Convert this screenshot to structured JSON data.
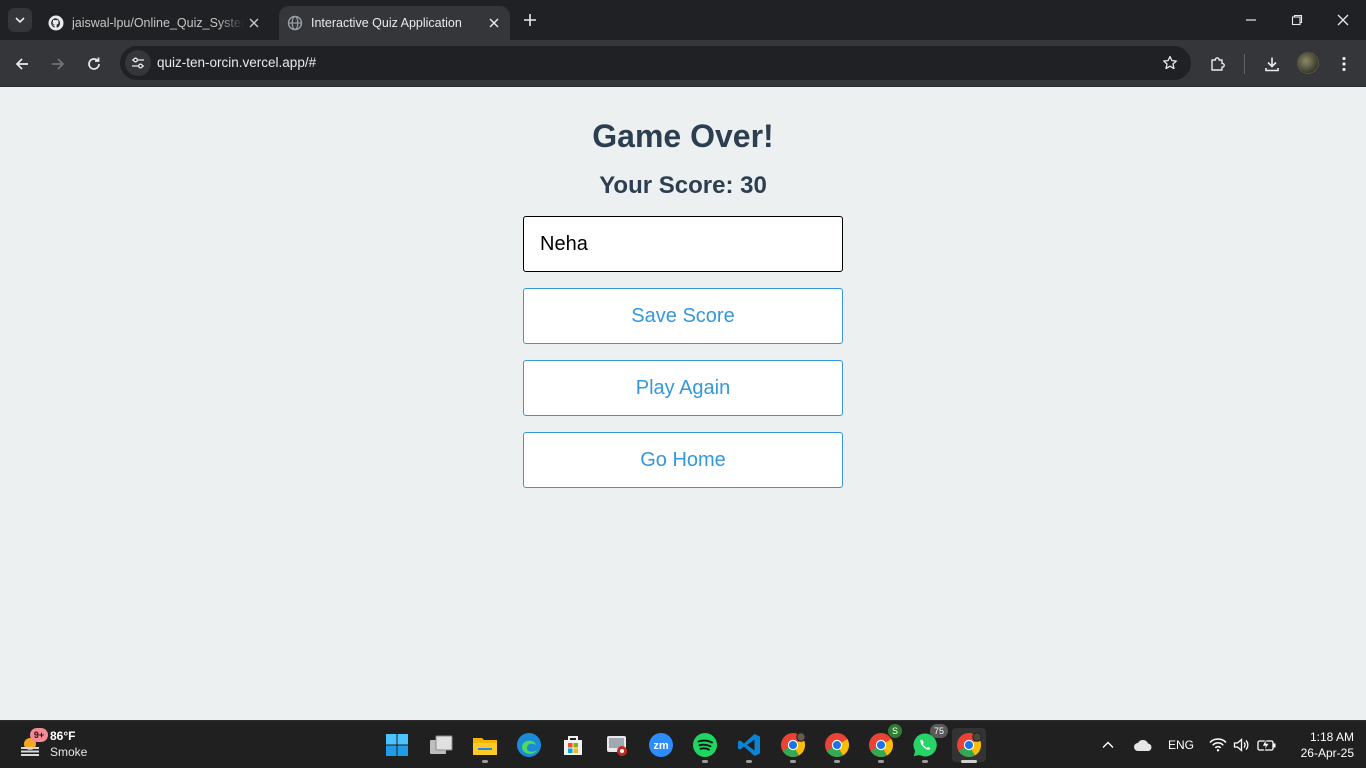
{
  "browser": {
    "tabs": [
      {
        "title": "jaiswal-lpu/Online_Quiz_System",
        "favicon": "github-icon",
        "active": false
      },
      {
        "title": "Interactive Quiz Application",
        "favicon": "globe-icon",
        "active": true
      }
    ],
    "url": "quiz-ten-orcin.vercel.app/#"
  },
  "page": {
    "heading": "Game Over!",
    "score_text": "Your Score: 30",
    "name_input": {
      "value": "Neha",
      "placeholder": ""
    },
    "buttons": {
      "save": "Save Score",
      "play_again": "Play Again",
      "home": "Go Home"
    },
    "colors": {
      "heading": "#2c3e50",
      "accent": "#3498db",
      "background": "#ecf0f1"
    }
  },
  "taskbar": {
    "weather": {
      "temp": "86°F",
      "condition": "Smoke",
      "badge": "9+"
    },
    "apps": [
      {
        "name": "start-icon"
      },
      {
        "name": "task-view-icon"
      },
      {
        "name": "file-explorer-icon"
      },
      {
        "name": "edge-icon"
      },
      {
        "name": "microsoft-store-icon"
      },
      {
        "name": "snipping-tool-icon"
      },
      {
        "name": "zoom-icon",
        "label": "zm"
      },
      {
        "name": "spotify-icon"
      },
      {
        "name": "vscode-icon"
      },
      {
        "name": "chrome-profile-1-icon"
      },
      {
        "name": "chrome-profile-2-icon"
      },
      {
        "name": "chrome-profile-3-icon",
        "badge": "S"
      },
      {
        "name": "whatsapp-icon",
        "badge": "75"
      },
      {
        "name": "chrome-active-icon"
      }
    ],
    "tray": {
      "language": "ENG"
    },
    "clock": {
      "time": "1:18 AM",
      "date": "26-Apr-25"
    }
  }
}
